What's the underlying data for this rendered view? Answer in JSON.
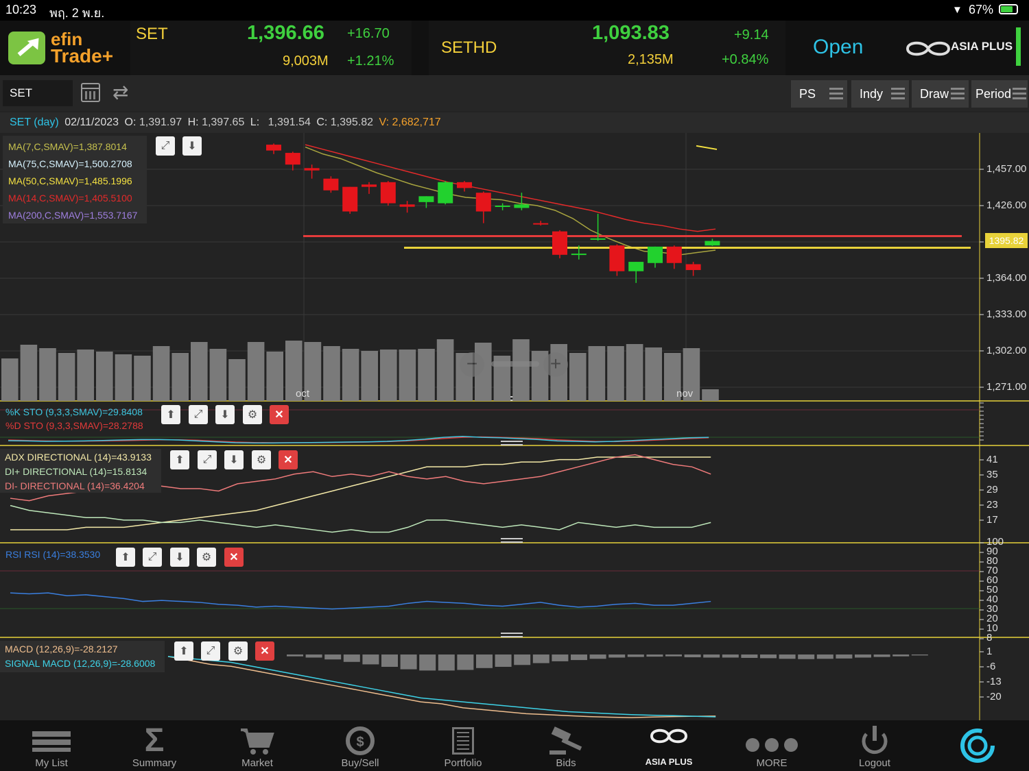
{
  "status_bar": {
    "time": "10:23",
    "date": "พฤ. 2 พ.ย.",
    "battery": "67%"
  },
  "brand": {
    "line1": "efin",
    "line2": "Trade+",
    "broker": "ASIA PLUS"
  },
  "market_status": "Open",
  "indices": [
    {
      "name": "SET",
      "value": "1,396.66",
      "change": "+16.70",
      "volume": "9,003M",
      "change_pct": "+1.21%"
    },
    {
      "name": "SETHD",
      "value": "1,093.83",
      "change": "+9.14",
      "volume": "2,135M",
      "change_pct": "+0.84%"
    }
  ],
  "toolbar": {
    "symbol": "SET",
    "buttons": [
      "PS",
      "Indy",
      "Draw",
      "Period"
    ]
  },
  "ohlc": {
    "symbol": "SET (day)",
    "date": "02/11/2023",
    "o_label": "O:",
    "o": "1,391.97",
    "h_label": "H:",
    "h": "1,397.65",
    "l_label": "L:",
    "l": "1,391.54",
    "c_label": "C:",
    "c": "1,395.82",
    "v_label": "V:",
    "v": "2,682,717"
  },
  "colors": {
    "up": "#22d12e",
    "down": "#e5151b",
    "accent": "#2ec3e6",
    "yellow": "#e8d23a"
  },
  "chart_data": [
    {
      "type": "candlestick",
      "name": "price",
      "x_labels": [
        "oct",
        "nov"
      ],
      "y_ticks": [
        "1,457.00",
        "1,426.00",
        "1,364.00",
        "1,333.00",
        "1,302.00",
        "1,271.00"
      ],
      "last_price_tag": "1395.82",
      "ylim": [
        1265,
        1475
      ],
      "candles": [
        [
          1478,
          1479,
          1470,
          1473
        ],
        [
          1471,
          1472,
          1456,
          1461
        ],
        [
          1458,
          1461,
          1449,
          1456
        ],
        [
          1449,
          1451,
          1437,
          1439
        ],
        [
          1442,
          1442,
          1419,
          1421
        ],
        [
          1444,
          1446,
          1436,
          1442
        ],
        [
          1446,
          1447,
          1426,
          1428
        ],
        [
          1427,
          1430,
          1420,
          1425
        ],
        [
          1429,
          1434,
          1424,
          1434
        ],
        [
          1428,
          1447,
          1427,
          1446
        ],
        [
          1446,
          1447,
          1438,
          1441
        ],
        [
          1437,
          1438,
          1411,
          1421
        ],
        [
          1426,
          1428,
          1422,
          1426
        ],
        [
          1424,
          1437,
          1422,
          1427
        ],
        [
          1411,
          1413,
          1409,
          1410
        ],
        [
          1404,
          1405,
          1381,
          1384
        ],
        [
          1385,
          1392,
          1380,
          1385
        ],
        [
          1398,
          1419,
          1396,
          1398
        ],
        [
          1392,
          1393,
          1366,
          1370
        ],
        [
          1370,
          1378,
          1360,
          1378
        ],
        [
          1377,
          1391,
          1373,
          1391
        ],
        [
          1391,
          1392,
          1372,
          1377
        ],
        [
          1376,
          1378,
          1366,
          1371
        ],
        [
          1391.97,
          1397.65,
          1391.54,
          1395.82
        ]
      ],
      "volume": [
        0.62,
        0.82,
        0.77,
        0.7,
        0.75,
        0.72,
        0.68,
        0.66,
        0.8,
        0.7,
        0.86,
        0.76,
        0.61,
        0.86,
        0.72,
        0.88,
        0.86,
        0.8,
        0.76,
        0.73,
        0.75,
        0.75,
        0.76,
        0.9,
        0.7,
        0.85,
        0.66,
        0.9,
        0.73,
        0.83,
        0.7,
        0.8,
        0.8,
        0.83,
        0.78,
        0.7,
        0.77,
        0.17
      ],
      "indicators": [
        {
          "label": "MA(7,C,SMAV)=1,387.8014",
          "color": "#c6c14e"
        },
        {
          "label": "MA(75,C,SMAV)=1,500.2708",
          "color": "#d7f3ff"
        },
        {
          "label": "MA(50,C,SMAV)=1,485.1996",
          "color": "#f5e241"
        },
        {
          "label": "MA(14,C,SMAV)=1,405.5100",
          "color": "#e52a2a"
        },
        {
          "label": "MA(200,C,SMAV)=1,553.7167",
          "color": "#9f7fe0"
        }
      ],
      "ma7": [
        1476,
        1470,
        1466,
        1460,
        1454,
        1449,
        1444,
        1440,
        1436,
        1433,
        1432,
        1431,
        1428,
        1426,
        1422,
        1415,
        1405,
        1398,
        1392,
        1387,
        1386,
        1384,
        1386,
        1388
      ],
      "ma14": [
        1478,
        1474,
        1470,
        1466,
        1462,
        1458,
        1454,
        1450,
        1446,
        1443,
        1440,
        1437,
        1434,
        1431,
        1428,
        1425,
        1422,
        1418,
        1414,
        1411,
        1409,
        1406,
        1404,
        1406
      ],
      "hlines": [
        {
          "value": 1400,
          "color": "#e53b3b"
        },
        {
          "value": 1390,
          "color": "#e8d23a"
        }
      ]
    },
    {
      "type": "line",
      "name": "stochastic",
      "series": [
        {
          "name": "%K STO (9,3,3,SMAV)=29.8408",
          "color": "#3ec7e0",
          "values": [
            15,
            14,
            12,
            13,
            14,
            16,
            18,
            20,
            20,
            18,
            14,
            10,
            6,
            5,
            5,
            6,
            7,
            8,
            9,
            10,
            12,
            16,
            22,
            30,
            34,
            30,
            28,
            24,
            20,
            14,
            12,
            10,
            12,
            16,
            20,
            24,
            28,
            30
          ]
        },
        {
          "name": "%D STO (9,3,3,SMAV)=28.2788",
          "color": "#e23a3a",
          "values": [
            18,
            16,
            14,
            13,
            13,
            14,
            15,
            17,
            19,
            19,
            17,
            13,
            9,
            7,
            6,
            6,
            6,
            7,
            8,
            9,
            11,
            14,
            19,
            25,
            30,
            32,
            30,
            27,
            24,
            19,
            15,
            12,
            11,
            13,
            17,
            21,
            25,
            28
          ]
        }
      ]
    },
    {
      "type": "line",
      "name": "adx",
      "y_ticks": [
        "41",
        "35",
        "29",
        "23",
        "17"
      ],
      "series": [
        {
          "name": "ADX DIRECTIONAL (14)=43.9133",
          "color": "#f4e9a8",
          "values": [
            14,
            14,
            14,
            14,
            15,
            15,
            15,
            16,
            17,
            18,
            19,
            20,
            21,
            22,
            24,
            26,
            28,
            30,
            32,
            34,
            36,
            38,
            40,
            40,
            40,
            41,
            41,
            42,
            42,
            43,
            43,
            44,
            44,
            44,
            44,
            44,
            44,
            44
          ]
        },
        {
          "name": "DI+ DIRECTIONAL (14)=15.8134",
          "color": "#bfe8bb",
          "values": [
            24,
            22,
            21,
            20,
            19,
            19,
            18,
            18,
            17,
            17,
            18,
            17,
            16,
            15,
            16,
            15,
            14,
            13,
            14,
            13,
            13,
            15,
            18,
            18,
            17,
            16,
            15,
            16,
            15,
            14,
            17,
            16,
            15,
            16,
            15,
            15,
            15,
            17
          ]
        },
        {
          "name": "DI- DIRECTIONAL (14)=36.4204",
          "color": "#f07b7b",
          "values": [
            27,
            26,
            28,
            29,
            30,
            31,
            32,
            33,
            32,
            31,
            31,
            30,
            33,
            34,
            35,
            37,
            38,
            36,
            37,
            36,
            38,
            36,
            35,
            36,
            34,
            33,
            34,
            35,
            36,
            38,
            40,
            42,
            44,
            45,
            43,
            41,
            40,
            37
          ]
        }
      ]
    },
    {
      "type": "line",
      "name": "rsi",
      "y_ticks": [
        "100",
        "90",
        "80",
        "70",
        "60",
        "50",
        "40",
        "30",
        "20",
        "10",
        "8"
      ],
      "series": [
        {
          "name": "RSI RSI (14)=38.3530",
          "color": "#3a7fe0",
          "values": [
            47,
            46,
            47,
            44,
            45,
            43,
            41,
            38,
            39,
            38,
            37,
            35,
            34,
            32,
            33,
            32,
            31,
            30,
            31,
            32,
            33,
            36,
            38,
            37,
            36,
            34,
            33,
            35,
            37,
            34,
            32,
            33,
            35,
            36,
            34,
            34,
            36,
            38
          ]
        }
      ]
    },
    {
      "type": "line",
      "name": "macd",
      "y_ticks": [
        "1",
        "-6",
        "-13",
        "-20"
      ],
      "series": [
        {
          "name": "MACD (12,26,9)=-28.2127",
          "color": "#f0bf8f",
          "values": [
            2,
            0,
            -2,
            -3,
            -5,
            -7,
            -9,
            -11,
            -13,
            -15,
            -17,
            -19,
            -21,
            -22,
            -24,
            -25,
            -26,
            -27,
            -27.5,
            -28,
            -28.5,
            -28.8,
            -29,
            -28.7,
            -28.5,
            -28.3,
            -28.2
          ]
        },
        {
          "name": "SIGNAL MACD (12,26,9)=-28.6008",
          "color": "#3ed3e8",
          "values": [
            2,
            1,
            0,
            -1,
            -3,
            -5,
            -7,
            -9,
            -11,
            -13,
            -15,
            -17,
            -19,
            -20,
            -21,
            -22,
            -23,
            -24,
            -25,
            -26,
            -26.5,
            -27,
            -27.5,
            -27.8,
            -28,
            -28.3,
            -28.6
          ]
        }
      ],
      "histogram": [
        0.3,
        0.5,
        0.8,
        1.2,
        1.6,
        2.0,
        2.4,
        2.6,
        2.6,
        2.5,
        2.2,
        2.0,
        1.7,
        1.4,
        1.1,
        0.9,
        0.7,
        0.5,
        0.4,
        0.35,
        0.3,
        0.45,
        0.5,
        0.5,
        0.55,
        0.6,
        0.7,
        0.75,
        0.7,
        0.65,
        0.5,
        0.4,
        0.3,
        0.15
      ]
    }
  ],
  "bottom_nav": [
    "My List",
    "Summary",
    "Market",
    "Buy/Sell",
    "Portfolio",
    "Bids",
    "ASIA PLUS",
    "MORE",
    "Logout"
  ]
}
